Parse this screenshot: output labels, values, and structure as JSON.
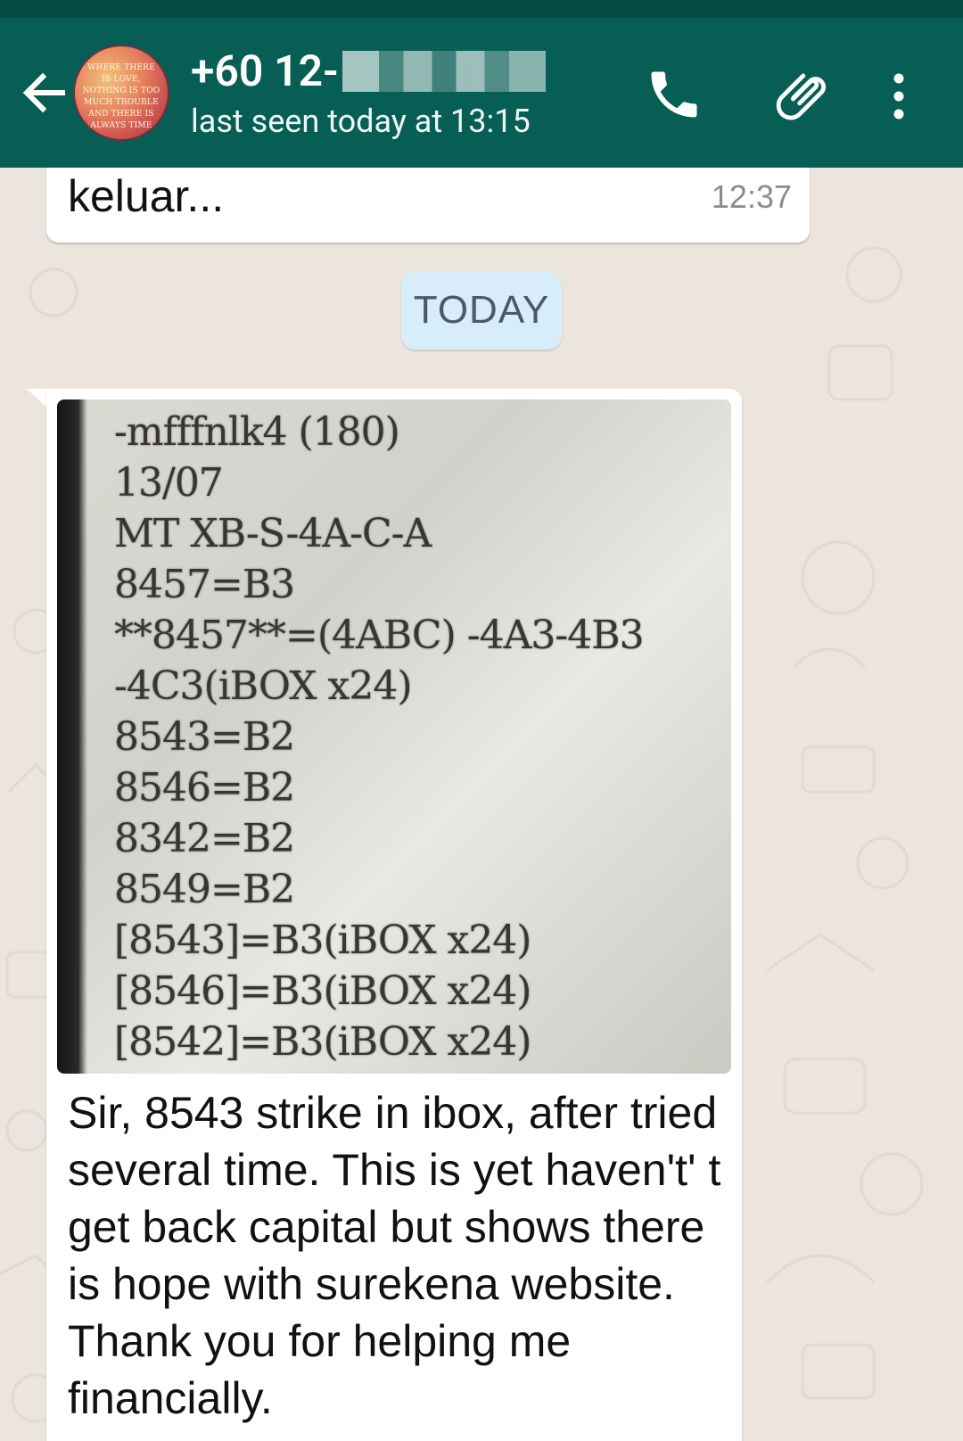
{
  "header": {
    "contact_name": "+60 12-",
    "status": "last seen today at 13:15",
    "avatar_text": "WHERE THERE IS LOVE, NOTHING IS TOO MUCH TROUBLE AND THERE IS ALWAYS TIME"
  },
  "messages": [
    {
      "text": "keluar...",
      "time": "12:37"
    },
    {
      "image_lines": [
        "-mfffnlk4 (180)",
        "13/07",
        "MT XB-S-4A-C-A",
        "8457=B3",
        "**8457**=(4ABC) -4A3-4B3",
        "-4C3(iBOX x24)",
        "8543=B2",
        "8546=B2",
        "8342=B2",
        "8549=B2",
        "[8543]=B3(iBOX x24)",
        "[8546]=B3(iBOX x24)",
        "[8542]=B3(iBOX x24)"
      ],
      "caption": "Sir, 8543 strike in ibox, after tried several time. This is yet haven't' t get back capital but shows there is hope with surekena website. Thank you for helping me financially."
    }
  ],
  "date_divider": "TODAY",
  "icons": {
    "back": "arrow-left-icon",
    "call": "phone-icon",
    "attach": "paperclip-icon",
    "more": "more-vert-icon"
  },
  "colors": {
    "header": "#075e54",
    "chat_background": "#ece5dd",
    "date_pill": "#d7eefa"
  }
}
